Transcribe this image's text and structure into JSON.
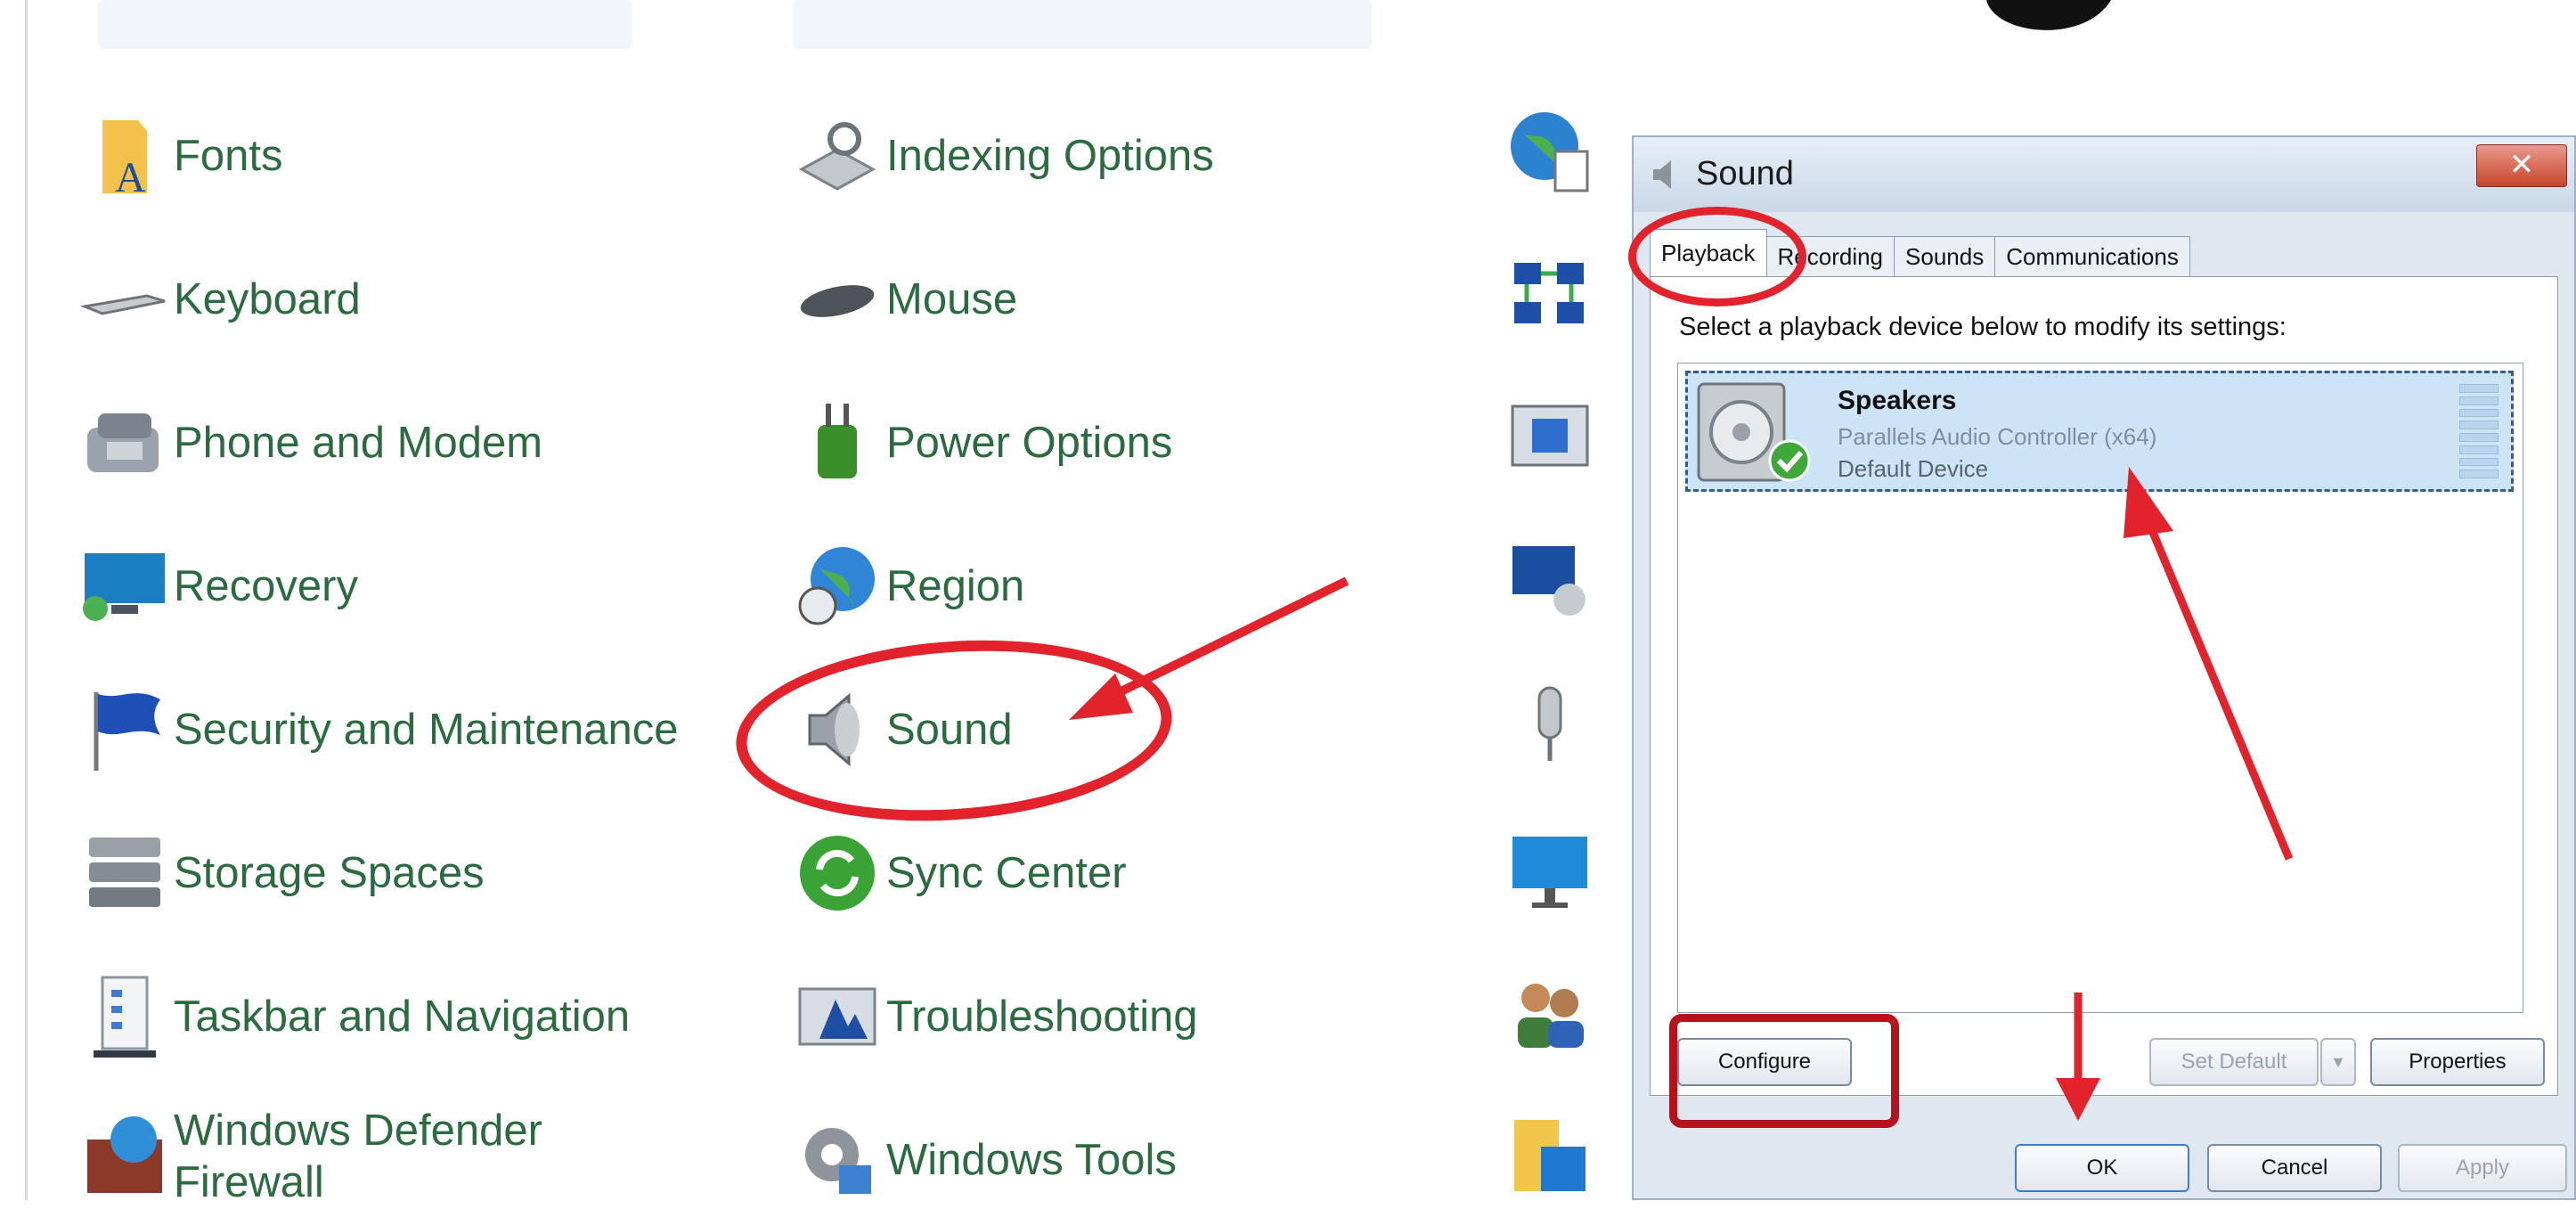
{
  "control_panel": {
    "columns": [
      [
        {
          "label": "Fonts",
          "icon": "fonts-folder-icon"
        },
        {
          "label": "Keyboard",
          "icon": "keyboard-icon"
        },
        {
          "label": "Phone and Modem",
          "icon": "phone-modem-icon"
        },
        {
          "label": "Recovery",
          "icon": "recovery-icon"
        },
        {
          "label": "Security and Maintenance",
          "icon": "security-flag-icon"
        },
        {
          "label": "Storage Spaces",
          "icon": "storage-spaces-icon"
        },
        {
          "label": "Taskbar and Navigation",
          "icon": "taskbar-icon"
        },
        {
          "label": "Windows Defender Firewall",
          "icon": "firewall-icon"
        }
      ],
      [
        {
          "label": "Indexing Options",
          "icon": "indexing-icon"
        },
        {
          "label": "Mouse",
          "icon": "mouse-icon"
        },
        {
          "label": "Power Options",
          "icon": "power-icon"
        },
        {
          "label": "Region",
          "icon": "globe-clock-icon"
        },
        {
          "label": "Sound",
          "icon": "speaker-icon"
        },
        {
          "label": "Sync Center",
          "icon": "sync-icon"
        },
        {
          "label": "Troubleshooting",
          "icon": "troubleshooting-icon"
        },
        {
          "label": "Windows Tools",
          "icon": "gear-tools-icon"
        }
      ]
    ],
    "third_column_icons": [
      "globe-doc-icon",
      "network-icon",
      "remoteapp-icon",
      "remote-desktop-icon",
      "microphone-icon",
      "monitor-icon",
      "users-icon",
      "work-folders-icon"
    ]
  },
  "sound_dialog": {
    "title": "Sound",
    "close_label": "✕",
    "tabs": [
      "Playback",
      "Recording",
      "Sounds",
      "Communications"
    ],
    "active_tab": "Playback",
    "instruction": "Select a playback device below to modify its settings:",
    "device": {
      "name": "Speakers",
      "controller": "Parallels Audio Controller (x64)",
      "status": "Default Device"
    },
    "buttons": {
      "configure": "Configure",
      "set_default": "Set Default",
      "properties": "Properties",
      "ok": "OK",
      "cancel": "Cancel",
      "apply": "Apply"
    }
  },
  "colors": {
    "annotation_red": "#e2232b",
    "label_green": "#2a6b3f",
    "selection_blue": "#cde4f7"
  }
}
